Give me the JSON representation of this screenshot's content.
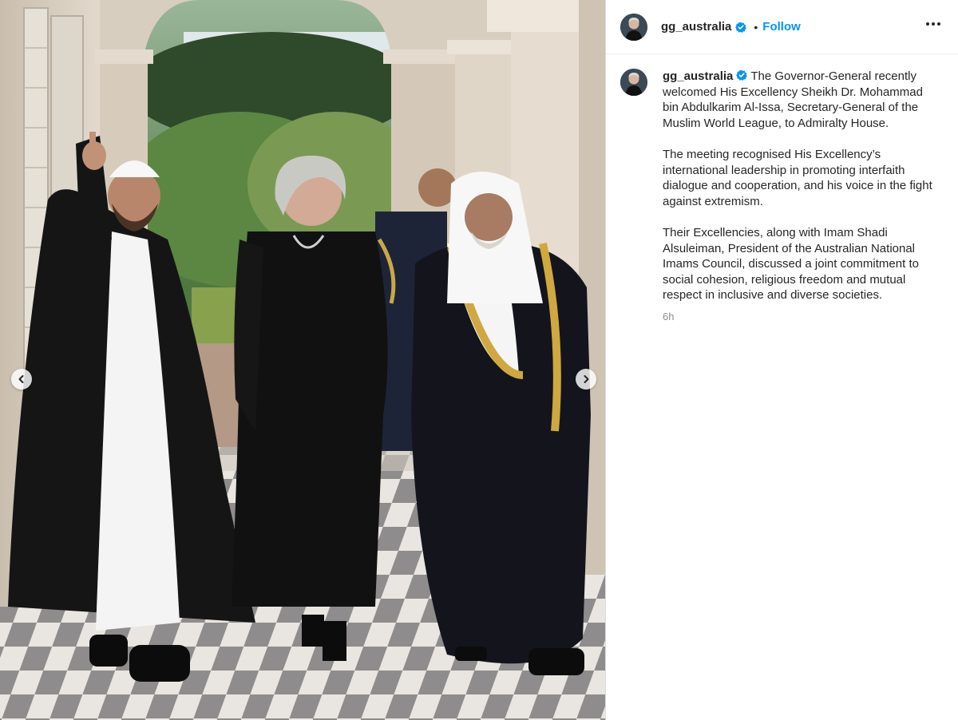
{
  "post": {
    "username": "gg_australia",
    "follow_label": "Follow",
    "separator": "•",
    "caption_paragraphs": [
      "The Governor-General recently welcomed His Excellency Sheikh Dr. Mohammad bin Abdulkarim Al-Issa, Secretary-General of the Muslim World League, to Admiralty House.",
      "The meeting recognised His Excellency’s international leadership in promoting interfaith dialogue and cooperation, and his voice in the fight against extremism.",
      "Their Excellencies, along with Imam Shadi Alsuleiman, President of the Australian National Imams Council, discussed a joint commitment to social cohesion, religious freedom and mutual respect in inclusive and diverse societies."
    ],
    "timestamp": "6h"
  },
  "icons": {
    "verified": "verified-badge-icon",
    "more": "more-options-icon",
    "prev": "chevron-left-icon",
    "next": "chevron-right-icon"
  },
  "colors": {
    "accent": "#0095f6",
    "verified": "#0095f6",
    "muted": "#8e8e8e",
    "text": "#262626"
  }
}
